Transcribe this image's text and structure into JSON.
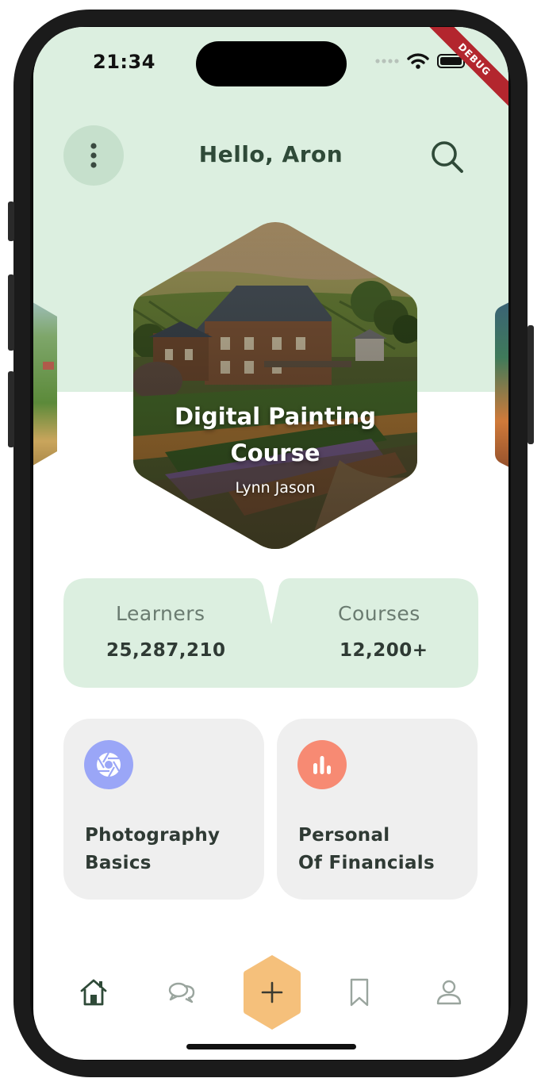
{
  "status_bar": {
    "time": "21:34",
    "debug_label": "DEBUG"
  },
  "header": {
    "greeting": "Hello, Aron"
  },
  "featured_course": {
    "title": "Digital Painting Course",
    "author": "Lynn Jason"
  },
  "stats": {
    "learners_label": "Learners",
    "learners_value": "25,287,210",
    "courses_label": "Courses",
    "courses_value": "12,200+"
  },
  "categories": [
    {
      "label": "Photography\nBasics",
      "icon": "aperture-icon",
      "color": "#9aa6f7"
    },
    {
      "label": "Personal\nOf Financials",
      "icon": "bar-chart-icon",
      "color": "#f78a73"
    }
  ],
  "nav": {
    "items": [
      "home-icon",
      "chat-icon",
      "add-icon",
      "bookmark-icon",
      "profile-icon"
    ],
    "accent": "#f5c07b"
  },
  "colors": {
    "header_bg": "#dcefe0",
    "stats_bg": "#dcefe0",
    "text_dark": "#2f4a38"
  }
}
